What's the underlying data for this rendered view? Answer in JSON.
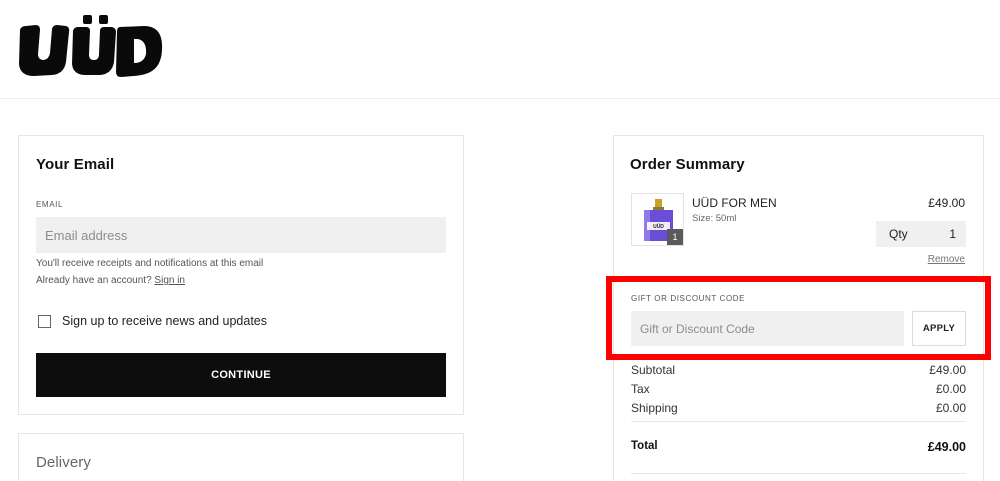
{
  "brand": {
    "logo_text": "UÜD"
  },
  "email_section": {
    "title": "Your Email",
    "email_label": "EMAIL",
    "email_placeholder": "Email address",
    "email_value": "",
    "helper_receipts": "You'll receive receipts and notifications at this email",
    "helper_account_prefix": "Already have an account?",
    "sign_in_link": "Sign in",
    "newsletter_label": "Sign up to receive news and updates",
    "newsletter_checked": false,
    "continue_label": "CONTINUE"
  },
  "delivery_section": {
    "title": "Delivery"
  },
  "order_summary": {
    "title": "Order Summary",
    "item": {
      "name": "UÜD FOR MEN",
      "size": "Size: 50ml",
      "price": "£49.00",
      "quantity_badge": "1",
      "qty_label": "Qty",
      "qty_value": "1",
      "remove_label": "Remove"
    },
    "discount": {
      "label": "GIFT OR DISCOUNT CODE",
      "placeholder": "Gift or Discount Code",
      "apply_label": "APPLY"
    },
    "totals": {
      "subtotal_label": "Subtotal",
      "subtotal_value": "£49.00",
      "tax_label": "Tax",
      "tax_value": "£0.00",
      "shipping_label": "Shipping",
      "shipping_value": "£0.00",
      "total_label": "Total",
      "total_value": "£49.00"
    }
  },
  "colors": {
    "primary_button": "#0d0d0d",
    "highlight_border": "#ff0000",
    "input_background": "#f0f0f0",
    "bottle_liquid": "#6a4fd6",
    "bottle_cap": "#c9a227"
  }
}
